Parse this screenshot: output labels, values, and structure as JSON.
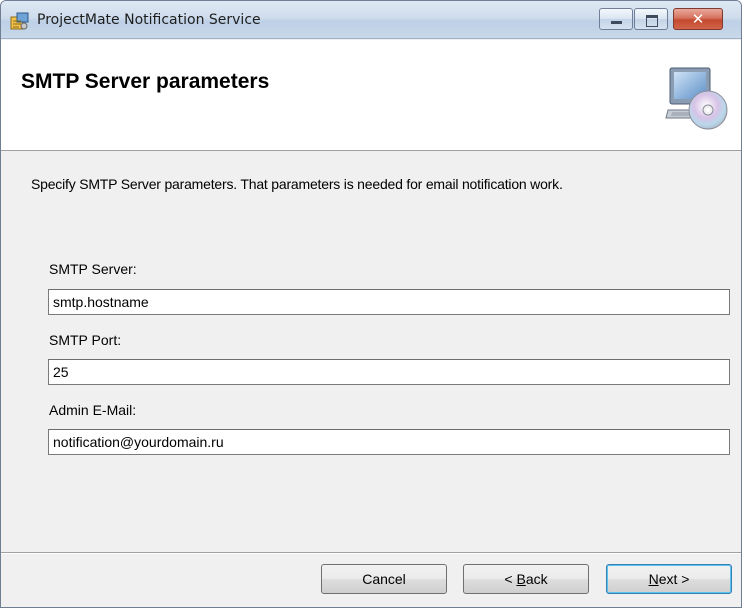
{
  "window": {
    "title": "ProjectMate Notification Service",
    "close_glyph": "✕"
  },
  "banner": {
    "title": "SMTP Server parameters",
    "icon": "computer-with-cd-icon"
  },
  "description": "Specify SMTP Server parameters. That parameters is needed for email notification work.",
  "fields": [
    {
      "label": "SMTP Server:",
      "value": "smtp.hostname"
    },
    {
      "label": "SMTP Port:",
      "value": "25"
    },
    {
      "label": "Admin E-Mail:",
      "value": "notification@yourdomain.ru"
    }
  ],
  "buttons": {
    "cancel": "Cancel",
    "back_mnemonic": "B",
    "back_rest": "ack",
    "back_prefix": "< ",
    "next_mnemonic": "N",
    "next_rest": "ext >"
  },
  "colors": {
    "titlebar": "#cfdcec",
    "close_button": "#c34a2f",
    "default_button_border": "#3c7fb1"
  }
}
